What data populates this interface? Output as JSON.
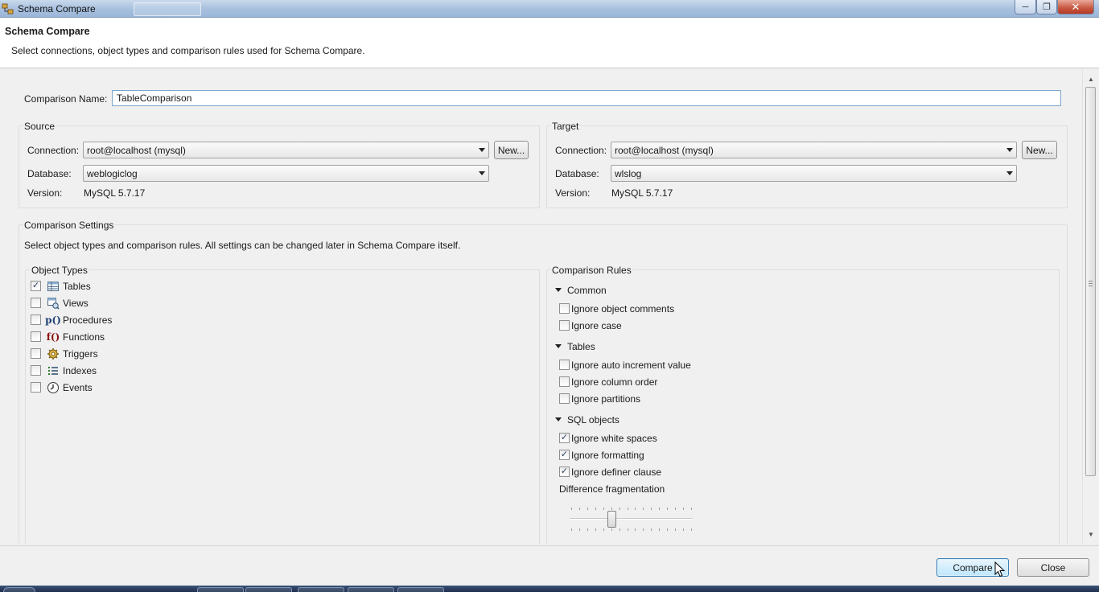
{
  "window": {
    "title": "Schema Compare"
  },
  "header": {
    "title": "Schema Compare",
    "description": "Select connections, object types and comparison rules used for Schema Compare."
  },
  "comparison": {
    "name_label": "Comparison Name:",
    "name_value": "TableComparison"
  },
  "source": {
    "title": "Source",
    "connection_label": "Connection:",
    "connection_value": "root@localhost (mysql)",
    "new_label": "New...",
    "database_label": "Database:",
    "database_value": "weblogiclog",
    "version_label": "Version:",
    "version_value": "MySQL 5.7.17"
  },
  "target": {
    "title": "Target",
    "connection_label": "Connection:",
    "connection_value": "root@localhost (mysql)",
    "new_label": "New...",
    "database_label": "Database:",
    "database_value": "wlslog",
    "version_label": "Version:",
    "version_value": "MySQL 5.7.17"
  },
  "settings": {
    "title": "Comparison Settings",
    "description": "Select object types and comparison rules. All settings can be changed later in Schema Compare itself."
  },
  "object_types": {
    "title": "Object Types",
    "items": [
      {
        "label": "Tables",
        "checked": true,
        "icon": "table-icon"
      },
      {
        "label": "Views",
        "checked": false,
        "icon": "view-icon"
      },
      {
        "label": "Procedures",
        "checked": false,
        "icon": "procedure-icon",
        "glyph": "p()"
      },
      {
        "label": "Functions",
        "checked": false,
        "icon": "function-icon",
        "glyph": "f()"
      },
      {
        "label": "Triggers",
        "checked": false,
        "icon": "trigger-icon"
      },
      {
        "label": "Indexes",
        "checked": false,
        "icon": "index-icon"
      },
      {
        "label": "Events",
        "checked": false,
        "icon": "event-icon"
      }
    ]
  },
  "rules": {
    "title": "Comparison Rules",
    "common": {
      "label": "Common",
      "items": [
        {
          "label": "Ignore object comments",
          "checked": false
        },
        {
          "label": "Ignore case",
          "checked": false
        }
      ]
    },
    "tables": {
      "label": "Tables",
      "items": [
        {
          "label": "Ignore auto increment value",
          "checked": false
        },
        {
          "label": "Ignore column order",
          "checked": false
        },
        {
          "label": "Ignore partitions",
          "checked": false
        }
      ]
    },
    "sql_objects": {
      "label": "SQL objects",
      "items": [
        {
          "label": "Ignore white spaces",
          "checked": true
        },
        {
          "label": "Ignore formatting",
          "checked": true
        },
        {
          "label": "Ignore definer clause",
          "checked": true
        }
      ]
    },
    "fragmentation": {
      "label": "Difference fragmentation",
      "level": 0.33
    }
  },
  "footer": {
    "compare_label": "Compare",
    "close_label": "Close"
  }
}
